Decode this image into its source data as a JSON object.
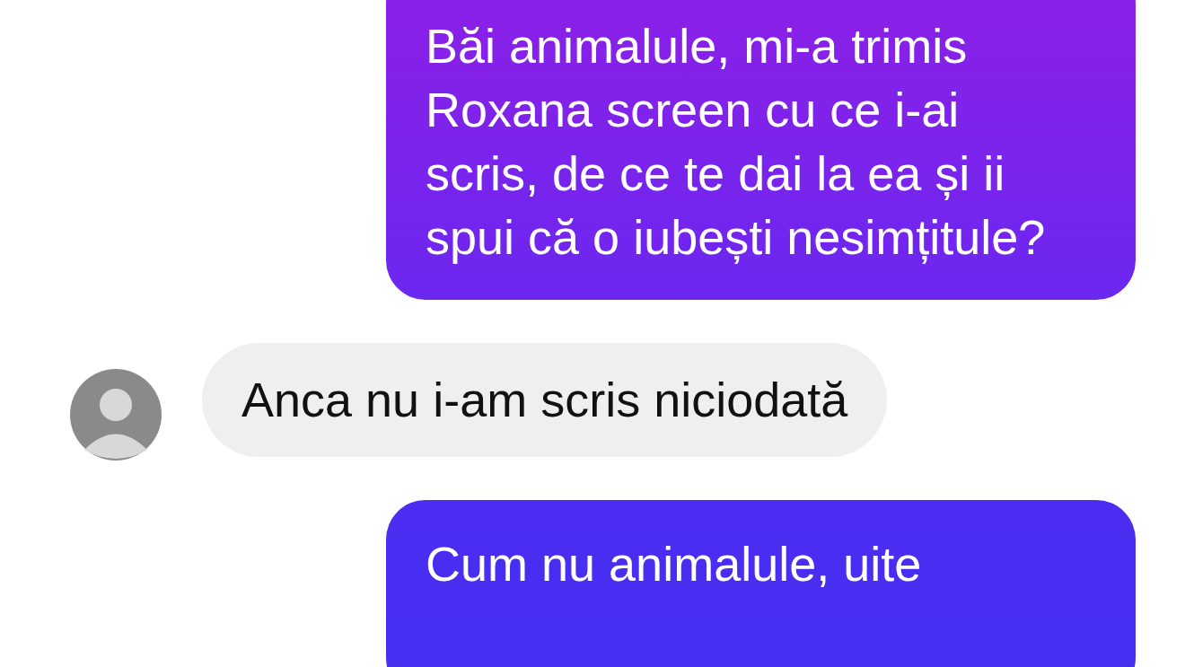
{
  "messages": [
    {
      "kind": "sent",
      "text": "Băi animalule, mi-a trimis Roxana screen cu ce i-ai scris, de ce te dai la ea și ii spui că o iubești nesimțitule?"
    },
    {
      "kind": "received",
      "text": "Anca nu i-am scris niciodată"
    },
    {
      "kind": "sent",
      "text": "Cum nu animalule, uite"
    }
  ]
}
